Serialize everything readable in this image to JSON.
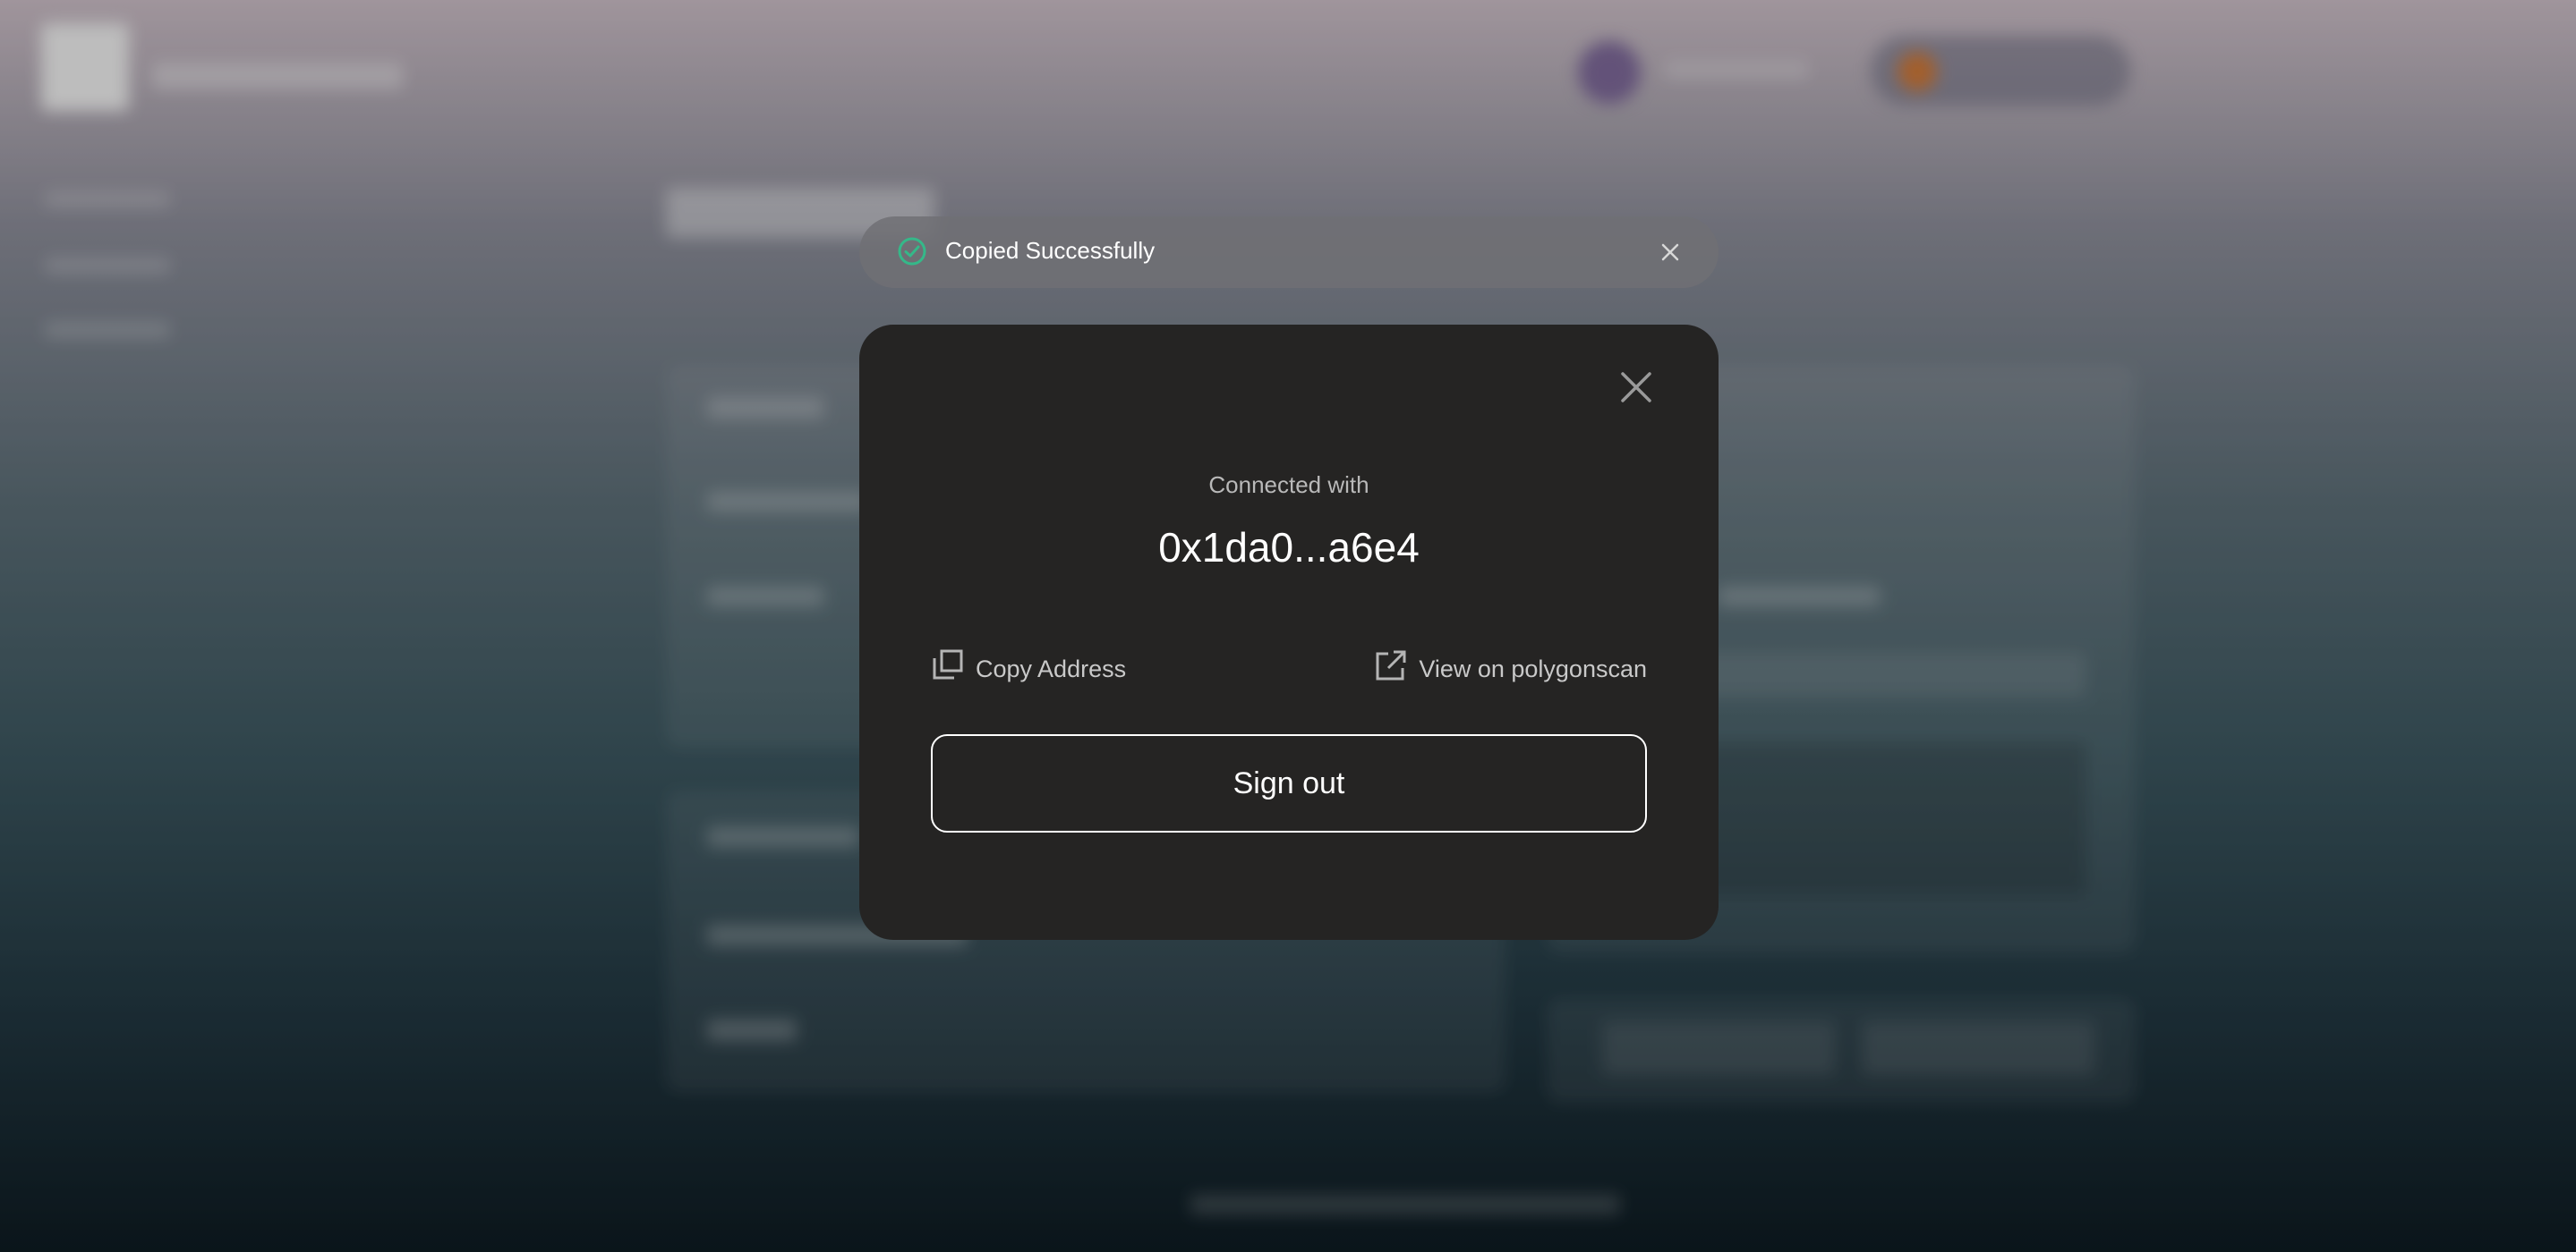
{
  "toast": {
    "message": "Copied Successfully",
    "icon": "check-circle-icon",
    "accent_color": "#35b889"
  },
  "modal": {
    "connected_label": "Connected with",
    "address": "0x1da0...a6e4",
    "copy_address_label": "Copy Address",
    "view_explorer_label": "View on polygonscan",
    "sign_out_label": "Sign out",
    "background_color": "#252423"
  }
}
